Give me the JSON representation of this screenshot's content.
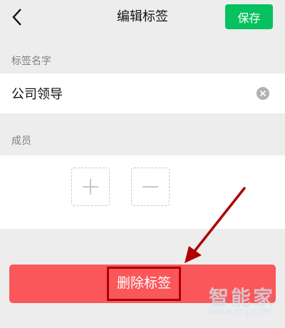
{
  "header": {
    "title": "编辑标签",
    "save_label": "保存"
  },
  "name_section": {
    "label": "标签名字",
    "value": "公司领导"
  },
  "members_section": {
    "label": "成员"
  },
  "delete_button": {
    "label": "删除标签"
  },
  "watermark": {
    "logo": "智能家",
    "url": "www.znj.com"
  },
  "colors": {
    "accent_green": "#07c160",
    "delete_red": "#f9575a",
    "annotation_red": "#b00000"
  }
}
